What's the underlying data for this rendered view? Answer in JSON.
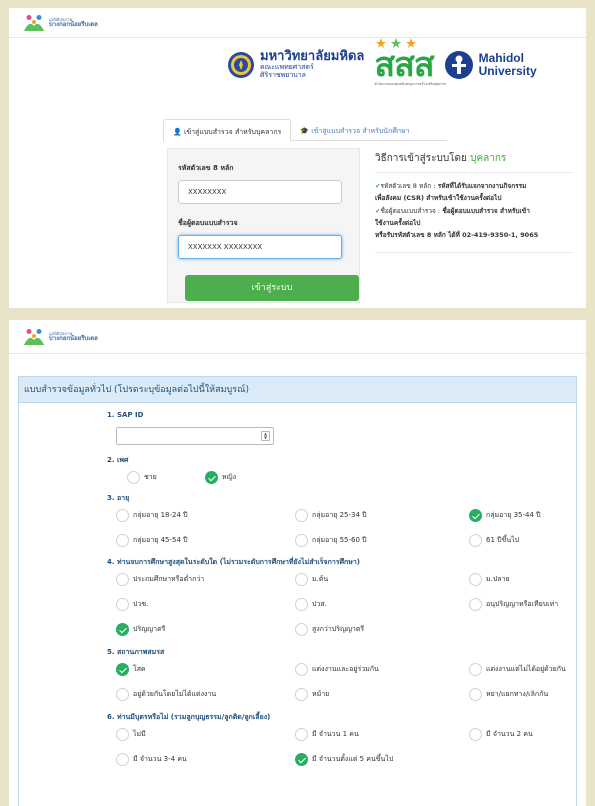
{
  "brand": {
    "sub": "มูลนิธิสุขภาพ",
    "name": "บางกอกน้อยรีบเดล"
  },
  "logos": {
    "mu_title": "มหาวิทยาลัยมหิดล",
    "mu_faculty": "คณะแพทยศาสตร์",
    "mu_hospital": "ศิริราชพยาบาล",
    "sss_text": "สสส",
    "sss_sub": "สำนักงานกองทุนสนับสนุนการสร้างเสริมสุขภาพ",
    "mahidol_line1": "Mahidol",
    "mahidol_line2": "University"
  },
  "login": {
    "tab_staff": "เข้าสู่แบบสำรวจ สำหรับบุคลากร",
    "tab_student": "เข้าสู่แบบสำรวจ สำหรับนักศึกษา",
    "id_label": "รหัสตัวเลข 8 หลัก",
    "id_value": "XXXXXXXX",
    "name_label": "ชื่อผู้ตอบแบบสำรวจ",
    "name_value": "XXXXXXX XXXXXXXX",
    "button": "เข้าสู่ระบบ"
  },
  "info": {
    "title_prefix": "วิธีการเข้าสู่ระบบโดย",
    "title_highlight": "บุคลากร",
    "check": "✔",
    "line1_label": "รหัสตัวเลข 8 หลัก :",
    "line1_text": "รหัสที่ได้รับแจกจากงานกิจกรรม",
    "line1_cont": "เพื่อสังคม (CSR) สำหรับเข้าใช้งานครั้งต่อไป",
    "line2_label": "ชื่อผู้ตอบแบบสำรวจ :",
    "line2_text": "ชื่อผู้ตอบแบบสำรวจ สำหรับเข้า",
    "line2_cont": "ใช้งานครั้งต่อไป",
    "line3": "หรือรับรหัสตัวเลข 8 หลัก ได้ที่ 02-419-9350-1, 9065"
  },
  "survey": {
    "header": "แบบสำรวจข้อมูลทั่วไป (โปรดระบุข้อมูลต่อไปนี้ให้สมบูรณ์)",
    "q1": "1. SAP ID",
    "q2": "2. เพศ",
    "q2_opts": [
      "ชาย",
      "หญิง"
    ],
    "q3": "3. อายุ",
    "q3_opts": [
      "กลุ่มอายุ 18-24 ปี",
      "กลุ่มอายุ 25-34 ปี",
      "กลุ่มอายุ 35-44 ปี",
      "กลุ่มอายุ 45-54 ปี",
      "กลุ่มอายุ 55-60 ปี",
      "61 ปีขึ้นไป"
    ],
    "q4": "4. ท่านจบการศึกษาสูงสุดในระดับใด (ไม่รวมระดับการศึกษาที่ยังไม่สำเร็จการศึกษา)",
    "q4_opts": [
      "ประถมศึกษาหรือต่ำกว่า",
      "ม.ต้น",
      "ม.ปลาย",
      "ปวช.",
      "ปวส.",
      "อนุปริญญาหรือเทียบเท่า",
      "ปริญญาตรี",
      "สูงกว่าปริญญาตรี"
    ],
    "q5": "5. สถานภาพสมรส",
    "q5_opts": [
      "โสด",
      "แต่งงานและอยู่ร่วมกัน",
      "แต่งงานแต่ไม่ได้อยู่ด้วยกัน",
      "อยู่ด้วยกันโดยไม่ได้แต่งงาน",
      "หม้าย",
      "หย่า/แยกทาง/เลิกกัน"
    ],
    "q6": "6. ท่านมีบุตรหรือไม่ (รวมลูกบุญธรรม/ลูกติด/ลูกเลี้ยง)",
    "q6_opts": [
      "ไม่มี",
      "มี จำนวน 1 คน",
      "มี จำนวน 2 คน",
      "มี จำนวน 3-4 คน",
      "มี จำนวนตั้งแต่ 5 คนขึ้นไป"
    ]
  }
}
